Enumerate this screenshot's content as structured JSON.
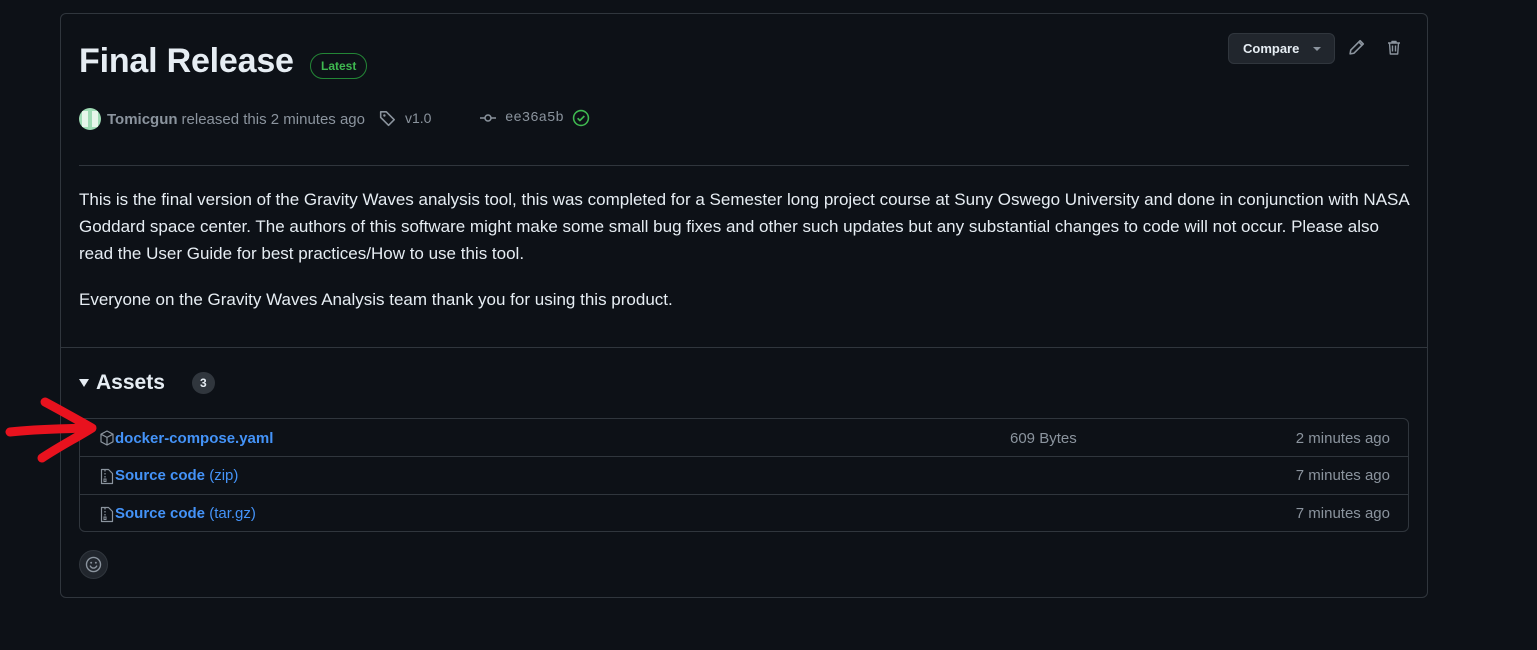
{
  "release": {
    "title": "Final Release",
    "badge": "Latest",
    "author": "Tomicgun",
    "released_text": "released this 2 minutes ago",
    "tag": "v1.0",
    "commit": "ee36a5b"
  },
  "toolbar": {
    "compare_label": "Compare"
  },
  "body": {
    "paragraph1": "This is the final version of the Gravity Waves analysis tool, this was completed for a Semester long project course at Suny Oswego University and done in conjunction with NASA Goddard space center. The authors of this software might make some small bug fixes and other such updates but any substantial changes to code will not occur. Please also read the User Guide for best practices/How to use this tool.",
    "paragraph2": "Everyone on the Gravity Waves Analysis team thank you for using this product."
  },
  "assets": {
    "title": "Assets",
    "count": "3",
    "items": [
      {
        "name": "docker-compose.yaml",
        "ext": "",
        "size": "609 Bytes",
        "time": "2 minutes ago"
      },
      {
        "name": "Source code",
        "ext": "(zip)",
        "size": "",
        "time": "7 minutes ago"
      },
      {
        "name": "Source code",
        "ext": "(tar.gz)",
        "size": "",
        "time": "7 minutes ago"
      }
    ]
  },
  "colors": {
    "background": "#0d1117",
    "border": "#30363d",
    "link": "#4493f8",
    "badge_green": "#3fb950",
    "muted": "#8b949e",
    "annotation_red": "#e8121e"
  },
  "icons": [
    "pencil-icon",
    "trash-icon",
    "tag-icon",
    "git-commit-icon",
    "verified-check-icon",
    "package-icon",
    "file-zip-icon",
    "smiley-icon",
    "triangle-down-icon"
  ]
}
